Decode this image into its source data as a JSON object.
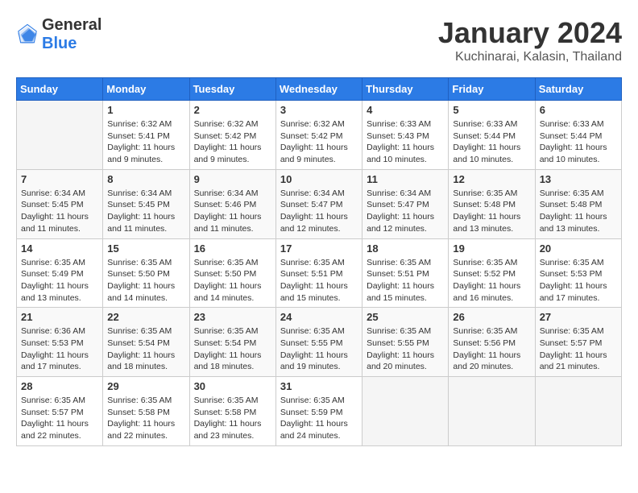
{
  "header": {
    "logo_general": "General",
    "logo_blue": "Blue",
    "main_title": "January 2024",
    "subtitle": "Kuchinarai, Kalasin, Thailand"
  },
  "calendar": {
    "days_of_week": [
      "Sunday",
      "Monday",
      "Tuesday",
      "Wednesday",
      "Thursday",
      "Friday",
      "Saturday"
    ],
    "weeks": [
      [
        {
          "day": "",
          "info": ""
        },
        {
          "day": "1",
          "info": "Sunrise: 6:32 AM\nSunset: 5:41 PM\nDaylight: 11 hours\nand 9 minutes."
        },
        {
          "day": "2",
          "info": "Sunrise: 6:32 AM\nSunset: 5:42 PM\nDaylight: 11 hours\nand 9 minutes."
        },
        {
          "day": "3",
          "info": "Sunrise: 6:32 AM\nSunset: 5:42 PM\nDaylight: 11 hours\nand 9 minutes."
        },
        {
          "day": "4",
          "info": "Sunrise: 6:33 AM\nSunset: 5:43 PM\nDaylight: 11 hours\nand 10 minutes."
        },
        {
          "day": "5",
          "info": "Sunrise: 6:33 AM\nSunset: 5:44 PM\nDaylight: 11 hours\nand 10 minutes."
        },
        {
          "day": "6",
          "info": "Sunrise: 6:33 AM\nSunset: 5:44 PM\nDaylight: 11 hours\nand 10 minutes."
        }
      ],
      [
        {
          "day": "7",
          "info": "Sunrise: 6:34 AM\nSunset: 5:45 PM\nDaylight: 11 hours\nand 11 minutes."
        },
        {
          "day": "8",
          "info": "Sunrise: 6:34 AM\nSunset: 5:45 PM\nDaylight: 11 hours\nand 11 minutes."
        },
        {
          "day": "9",
          "info": "Sunrise: 6:34 AM\nSunset: 5:46 PM\nDaylight: 11 hours\nand 11 minutes."
        },
        {
          "day": "10",
          "info": "Sunrise: 6:34 AM\nSunset: 5:47 PM\nDaylight: 11 hours\nand 12 minutes."
        },
        {
          "day": "11",
          "info": "Sunrise: 6:34 AM\nSunset: 5:47 PM\nDaylight: 11 hours\nand 12 minutes."
        },
        {
          "day": "12",
          "info": "Sunrise: 6:35 AM\nSunset: 5:48 PM\nDaylight: 11 hours\nand 13 minutes."
        },
        {
          "day": "13",
          "info": "Sunrise: 6:35 AM\nSunset: 5:48 PM\nDaylight: 11 hours\nand 13 minutes."
        }
      ],
      [
        {
          "day": "14",
          "info": "Sunrise: 6:35 AM\nSunset: 5:49 PM\nDaylight: 11 hours\nand 13 minutes."
        },
        {
          "day": "15",
          "info": "Sunrise: 6:35 AM\nSunset: 5:50 PM\nDaylight: 11 hours\nand 14 minutes."
        },
        {
          "day": "16",
          "info": "Sunrise: 6:35 AM\nSunset: 5:50 PM\nDaylight: 11 hours\nand 14 minutes."
        },
        {
          "day": "17",
          "info": "Sunrise: 6:35 AM\nSunset: 5:51 PM\nDaylight: 11 hours\nand 15 minutes."
        },
        {
          "day": "18",
          "info": "Sunrise: 6:35 AM\nSunset: 5:51 PM\nDaylight: 11 hours\nand 15 minutes."
        },
        {
          "day": "19",
          "info": "Sunrise: 6:35 AM\nSunset: 5:52 PM\nDaylight: 11 hours\nand 16 minutes."
        },
        {
          "day": "20",
          "info": "Sunrise: 6:35 AM\nSunset: 5:53 PM\nDaylight: 11 hours\nand 17 minutes."
        }
      ],
      [
        {
          "day": "21",
          "info": "Sunrise: 6:36 AM\nSunset: 5:53 PM\nDaylight: 11 hours\nand 17 minutes."
        },
        {
          "day": "22",
          "info": "Sunrise: 6:35 AM\nSunset: 5:54 PM\nDaylight: 11 hours\nand 18 minutes."
        },
        {
          "day": "23",
          "info": "Sunrise: 6:35 AM\nSunset: 5:54 PM\nDaylight: 11 hours\nand 18 minutes."
        },
        {
          "day": "24",
          "info": "Sunrise: 6:35 AM\nSunset: 5:55 PM\nDaylight: 11 hours\nand 19 minutes."
        },
        {
          "day": "25",
          "info": "Sunrise: 6:35 AM\nSunset: 5:55 PM\nDaylight: 11 hours\nand 20 minutes."
        },
        {
          "day": "26",
          "info": "Sunrise: 6:35 AM\nSunset: 5:56 PM\nDaylight: 11 hours\nand 20 minutes."
        },
        {
          "day": "27",
          "info": "Sunrise: 6:35 AM\nSunset: 5:57 PM\nDaylight: 11 hours\nand 21 minutes."
        }
      ],
      [
        {
          "day": "28",
          "info": "Sunrise: 6:35 AM\nSunset: 5:57 PM\nDaylight: 11 hours\nand 22 minutes."
        },
        {
          "day": "29",
          "info": "Sunrise: 6:35 AM\nSunset: 5:58 PM\nDaylight: 11 hours\nand 22 minutes."
        },
        {
          "day": "30",
          "info": "Sunrise: 6:35 AM\nSunset: 5:58 PM\nDaylight: 11 hours\nand 23 minutes."
        },
        {
          "day": "31",
          "info": "Sunrise: 6:35 AM\nSunset: 5:59 PM\nDaylight: 11 hours\nand 24 minutes."
        },
        {
          "day": "",
          "info": ""
        },
        {
          "day": "",
          "info": ""
        },
        {
          "day": "",
          "info": ""
        }
      ]
    ]
  }
}
